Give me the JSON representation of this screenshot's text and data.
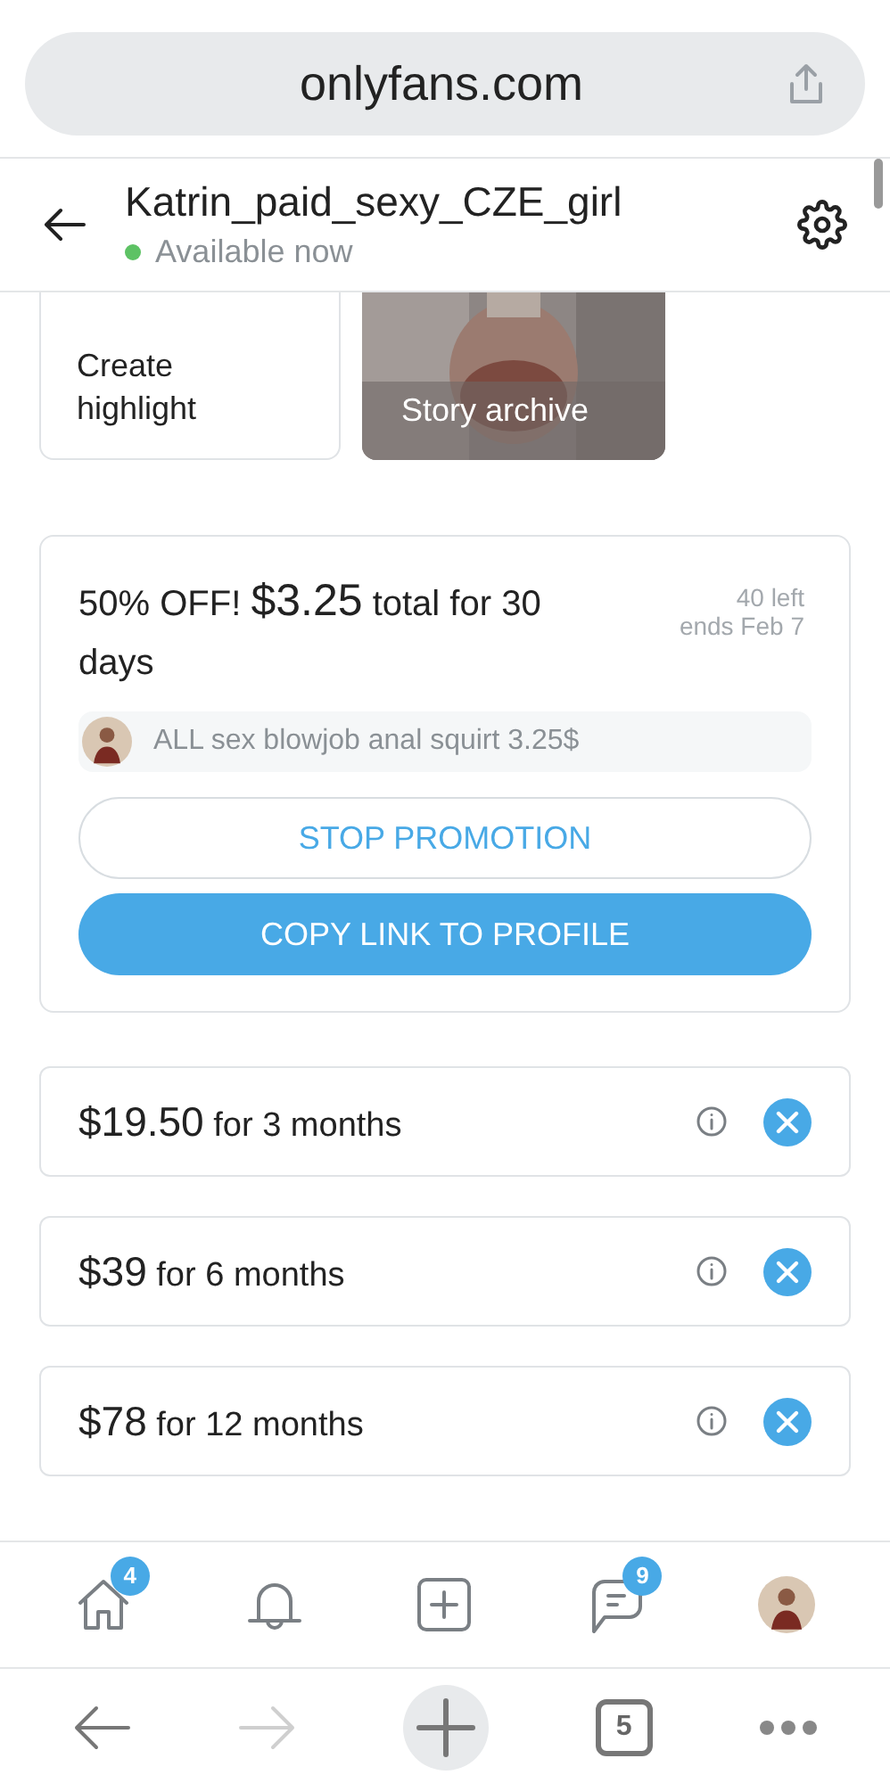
{
  "browser": {
    "url": "onlyfans.com",
    "tab_count": "5"
  },
  "header": {
    "title": "Katrin_paid_sexy_CZE_girl",
    "status": "Available now",
    "online": true
  },
  "highlights": [
    {
      "kind": "create",
      "label": "Create highlight"
    },
    {
      "kind": "archive",
      "label": "Story archive"
    }
  ],
  "promotion": {
    "discount": "50% OFF!",
    "price": "$3.25",
    "text": "total for 30 days",
    "remaining": "40 left",
    "ends": "ends Feb 7",
    "message": "ALL sex blowjob anal squirt 3.25$",
    "buttons": [
      {
        "kind": "outline",
        "label": "STOP PROMOTION"
      },
      {
        "kind": "filled",
        "label": "COPY LINK TO PROFILE"
      }
    ]
  },
  "bundles": [
    {
      "price": "$19.50",
      "period": "for 3 months"
    },
    {
      "price": "$39",
      "period": "for 6 months"
    },
    {
      "price": "$78",
      "period": "for 12 months"
    }
  ],
  "nav": [
    {
      "kind": "home",
      "badge": "4"
    },
    {
      "kind": "bell"
    },
    {
      "kind": "add"
    },
    {
      "kind": "chat",
      "badge": "9"
    },
    {
      "kind": "avatar"
    }
  ]
}
